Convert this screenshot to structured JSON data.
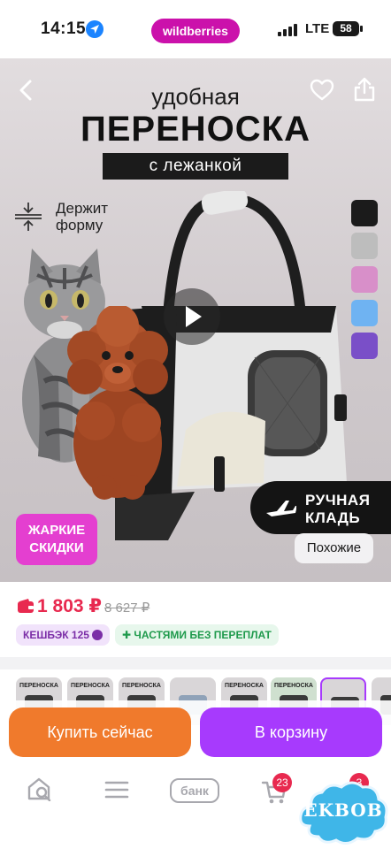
{
  "status_bar": {
    "time": "14:15",
    "brand": "wildberries",
    "network": "LTE",
    "battery": "58"
  },
  "hero": {
    "title_small": "удобная",
    "title_big": "ПЕРЕНОСКА",
    "title_tag": "с лежанкой",
    "feature": "Держит форму",
    "badge_hand": "РУЧНАЯ КЛАДЬ",
    "badge_hot": "ЖАРКИЕ СКИДКИ",
    "similar": "Похожие",
    "colors": [
      "#1b1b1b",
      "#bdbdbd",
      "#d88fc9",
      "#6fb3f2",
      "#7a4fc8"
    ]
  },
  "price": {
    "current": "1 803 ₽",
    "old": "8 627 ₽"
  },
  "chips": {
    "cashback": "КЕШБЭК 125",
    "parts": "ЧАСТЯМИ БЕЗ ПЕРЕПЛАТ"
  },
  "thumbnails": [
    {
      "label": "ПЕРЕНОСКА"
    },
    {
      "label": "ПЕРЕНОСКА"
    },
    {
      "label": "ПЕРЕНОСКА"
    },
    {
      "label": ""
    },
    {
      "label": "ПЕРЕНОСКА"
    },
    {
      "label": "ПЕРЕНОСКА"
    },
    {
      "label": ""
    },
    {
      "label": ""
    }
  ],
  "actions": {
    "buy": "Купить сейчас",
    "cart": "В корзину"
  },
  "nav": {
    "bank": "банк",
    "cart_count": "23",
    "profile_count": "3"
  },
  "watermark": "EKBOB",
  "colors": {
    "brand": "#cb11ab",
    "price": "#e8294f",
    "buy": "#f07a2c",
    "cart": "#a73afd"
  }
}
